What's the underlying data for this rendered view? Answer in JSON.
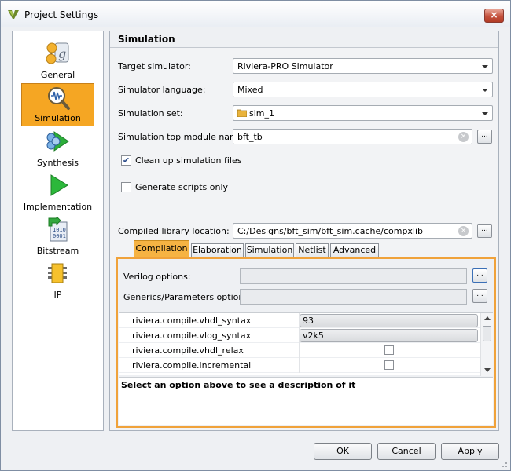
{
  "window": {
    "title": "Project Settings",
    "close_glyph": "×"
  },
  "sidebar": {
    "selected_color": "#f5a623",
    "items": [
      {
        "label": "General",
        "icon": "general-icon"
      },
      {
        "label": "Simulation",
        "icon": "simulation-icon"
      },
      {
        "label": "Synthesis",
        "icon": "synthesis-icon"
      },
      {
        "label": "Implementation",
        "icon": "implementation-icon"
      },
      {
        "label": "Bitstream",
        "icon": "bitstream-icon"
      },
      {
        "label": "IP",
        "icon": "ip-icon"
      }
    ]
  },
  "main": {
    "title": "Simulation",
    "target_simulator": {
      "label": "Target simulator:",
      "value": "Riviera-PRO Simulator"
    },
    "simulator_language": {
      "label": "Simulator language:",
      "value": "Mixed"
    },
    "simulation_set": {
      "label": "Simulation set:",
      "value": "sim_1"
    },
    "top_module": {
      "label": "Simulation top module name:",
      "value": "bft_tb"
    },
    "cleanup": {
      "label": "Clean up simulation files",
      "checked": true,
      "check_glyph": "✔"
    },
    "generate_scripts": {
      "label": "Generate scripts only",
      "checked": false
    },
    "compiled_lib": {
      "label": "Compiled library location:",
      "value": "C:/Designs/bft_sim/bft_sim.cache/compxlib"
    },
    "browse_label": "...",
    "clear_glyph": "×"
  },
  "tabs": [
    {
      "label": "Compilation",
      "active": true
    },
    {
      "label": "Elaboration",
      "active": false
    },
    {
      "label": "Simulation",
      "active": false
    },
    {
      "label": "Netlist",
      "active": false
    },
    {
      "label": "Advanced",
      "active": false
    }
  ],
  "compilation": {
    "verilog_options_label": "Verilog options:",
    "generics_label": "Generics/Parameters options:",
    "properties": [
      {
        "name": "riviera.compile.vhdl_syntax",
        "value": "93"
      },
      {
        "name": "riviera.compile.vlog_syntax",
        "value": "v2k5"
      },
      {
        "name": "riviera.compile.vhdl_relax",
        "checked": false
      },
      {
        "name": "riviera.compile.incremental",
        "checked": false
      }
    ],
    "description": "Select an option above to see a description of it"
  },
  "buttons": {
    "ok": "OK",
    "cancel": "Cancel",
    "apply": "Apply"
  }
}
